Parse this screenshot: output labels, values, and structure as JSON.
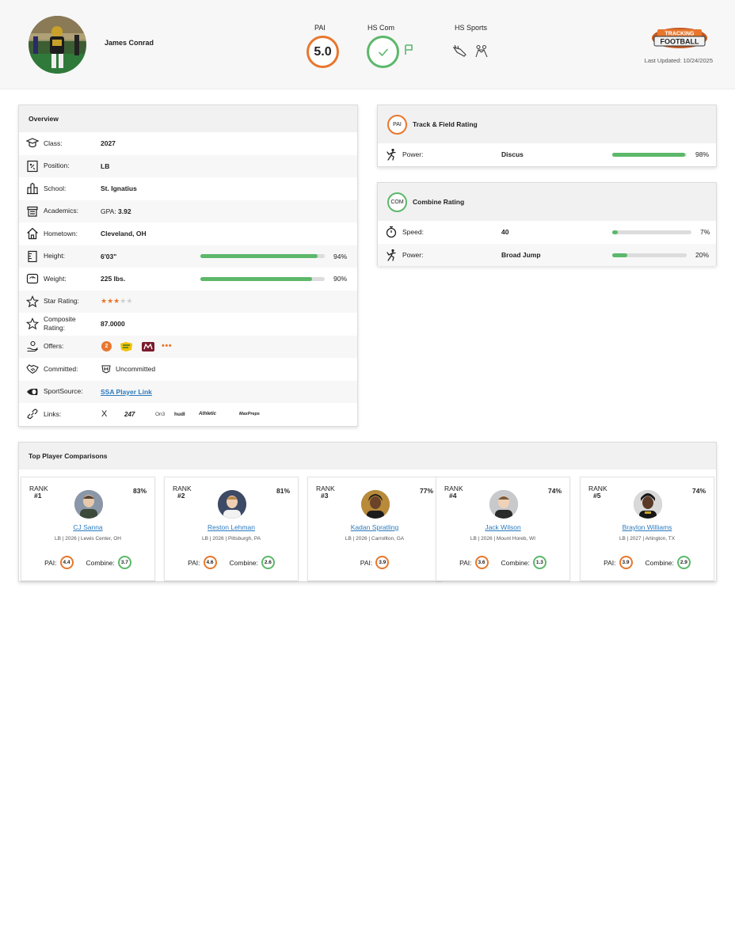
{
  "header": {
    "player_name": "James Conrad",
    "pai_label": "PAI",
    "pai_value": "5.0",
    "hscom_label": "HS Com",
    "hs_sports_label": "HS Sports",
    "last_updated": "Last Updated: 10/24/2025",
    "logo_top": "TRACKING",
    "logo_bottom": "FOOTBALL",
    "colors": {
      "pai_ring": "#e8772e",
      "com_ring": "#5cb86a",
      "link": "#2b7bbf"
    },
    "icons": [
      "check-icon",
      "flag-icon",
      "track-shoe-icon",
      "wrestling-icon"
    ]
  },
  "overview": {
    "title": "Overview",
    "rows": [
      {
        "label": "Class:",
        "value": "2027",
        "icon": "graduation-cap-icon"
      },
      {
        "label": "Position:",
        "value": "LB",
        "icon": "playbook-icon"
      },
      {
        "label": "School:",
        "value": "St. Ignatius",
        "icon": "school-icon"
      },
      {
        "label": "Academics:",
        "value_prefix": "GPA: ",
        "value": "3.92",
        "icon": "academics-icon"
      },
      {
        "label": "Hometown:",
        "value": "Cleveland, OH",
        "icon": "home-icon"
      },
      {
        "label": "Height:",
        "value": "6'03\"",
        "pct": "94%",
        "fill": 0.94,
        "icon": "ruler-icon"
      },
      {
        "label": "Weight:",
        "value": "225 lbs.",
        "pct": "90%",
        "fill": 0.9,
        "icon": "scale-icon"
      },
      {
        "label": "Star Rating:",
        "stars": 3,
        "stars_max": 5,
        "icon": "star-icon"
      },
      {
        "label_1": "Composite",
        "label_2": "Rating:",
        "value": "87.0000",
        "icon": "star-icon"
      },
      {
        "label": "Offers:",
        "offer_count": "2",
        "icon": "offers-icon"
      },
      {
        "label": "Committed:",
        "value": "Uncommitted",
        "icon": "handshake-icon"
      },
      {
        "label": "SportSource:",
        "value": "SSA Player Link",
        "icon": "sportsource-icon"
      },
      {
        "label": "Links:",
        "links": [
          "X",
          "247",
          "On3",
          "hudl",
          "Athletic",
          "MaxPreps"
        ],
        "icon": "link-icon"
      }
    ]
  },
  "track_rating": {
    "badge": "PAI",
    "title": "Track & Field Rating",
    "rows": [
      {
        "label": "Power:",
        "event": "Discus",
        "pct": "98%",
        "fill": 0.98,
        "icon": "thrower-icon"
      }
    ]
  },
  "combine_rating": {
    "badge": "COM",
    "title": "Combine Rating",
    "rows": [
      {
        "label": "Speed:",
        "event": "40",
        "pct": "7%",
        "fill": 0.07,
        "icon": "stopwatch-icon"
      },
      {
        "label": "Power:",
        "event": "Broad Jump",
        "pct": "20%",
        "fill": 0.2,
        "icon": "thrower-icon"
      }
    ]
  },
  "comparisons": {
    "title": "Top Player Comparisons",
    "rank_label": "RANK",
    "pai_label": "PAI:",
    "combine_label": "Combine:",
    "players": [
      {
        "rank": "#1",
        "pct": "83%",
        "name": "CJ Sanna",
        "meta": "LB | 2026 | Lewis Center, OH",
        "pai": "4.4",
        "combine": "3.7"
      },
      {
        "rank": "#2",
        "pct": "81%",
        "name": "Reston Lehman",
        "meta": "LB | 2026 | Pittsburgh, PA",
        "pai": "4.6",
        "combine": "2.6"
      },
      {
        "rank": "#3",
        "pct": "77%",
        "name": "Kadan Spratling",
        "meta": "LB | 2026 | Carrollton, GA",
        "pai": "3.9",
        "combine": null
      },
      {
        "rank": "#4",
        "pct": "74%",
        "name": "Jack Wilson",
        "meta": "LB | 2026 | Mount Horeb, WI",
        "pai": "3.6",
        "combine": "1.3"
      },
      {
        "rank": "#5",
        "pct": "74%",
        "name": "Braylon Williams",
        "meta": "LB | 2027 | Arlington, TX",
        "pai": "3.9",
        "combine": "2.9"
      }
    ]
  }
}
